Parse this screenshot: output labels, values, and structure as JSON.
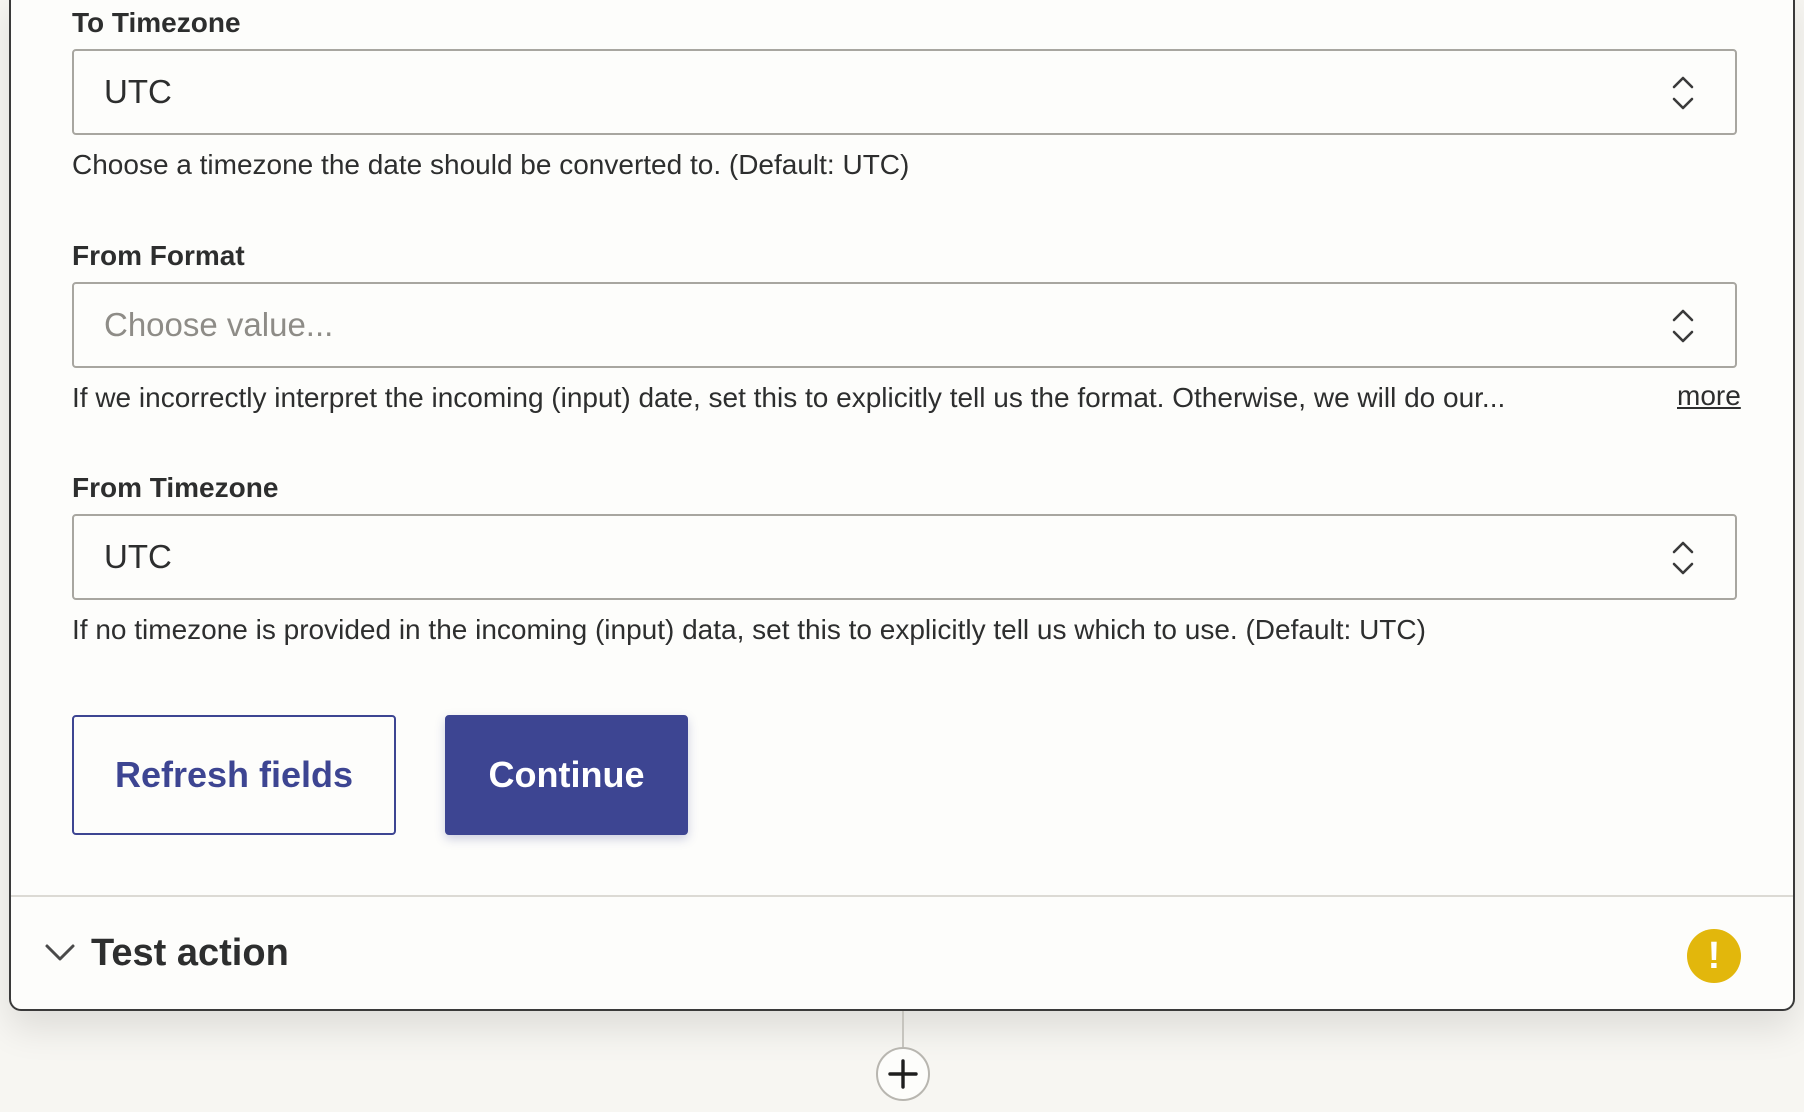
{
  "fields": [
    {
      "label": "To Timezone",
      "value": "UTC",
      "placeholder": "",
      "help": "Choose a timezone the date should be converted to. (Default: UTC)"
    },
    {
      "label": "From Format",
      "value": "",
      "placeholder": "Choose value...",
      "help": "If we incorrectly interpret the incoming (input) date, set this to explicitly tell us the format. Otherwise, we will do our...",
      "more_label": "more"
    },
    {
      "label": "From Timezone",
      "value": "UTC",
      "placeholder": "",
      "help": "If no timezone is provided in the incoming (input) data, set this to explicitly tell us which to use. (Default: UTC)"
    }
  ],
  "buttons": {
    "refresh_label": "Refresh fields",
    "continue_label": "Continue"
  },
  "test_section": {
    "title": "Test action",
    "status_icon": "warning-icon",
    "status_symbol": "!",
    "status_color": "#e2b70c"
  },
  "add_step": {
    "icon": "plus-icon"
  },
  "colors": {
    "primary": "#3d4592",
    "warning": "#e2b70c"
  }
}
